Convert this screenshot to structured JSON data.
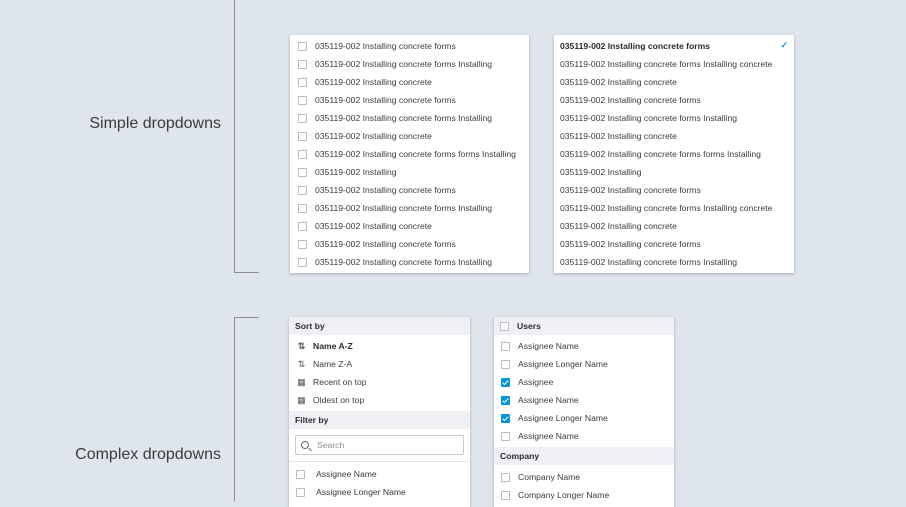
{
  "sections": {
    "simple_label": "Simple dropdowns",
    "complex_label": "Complex dropdowns"
  },
  "simple_checkbox_list": {
    "items": [
      {
        "label": "035119-002 Installing concrete forms",
        "checked": false
      },
      {
        "label": "035119-002 Installing concrete forms Installing",
        "checked": false
      },
      {
        "label": "035119-002 Installing concrete",
        "checked": false
      },
      {
        "label": "035119-002 Installing concrete forms",
        "checked": false
      },
      {
        "label": "035119-002 Installing concrete forms Installing",
        "checked": false
      },
      {
        "label": "035119-002 Installing concrete",
        "checked": false
      },
      {
        "label": "035119-002 Installing concrete forms forms Installing",
        "checked": false
      },
      {
        "label": "035119-002 Installing",
        "checked": false
      },
      {
        "label": "035119-002 Installing concrete forms",
        "checked": false
      },
      {
        "label": "035119-002 Installing concrete forms Installing",
        "checked": false
      },
      {
        "label": "035119-002 Installing concrete",
        "checked": false
      },
      {
        "label": "035119-002 Installing concrete forms",
        "checked": false
      },
      {
        "label": "035119-002 Installing concrete forms Installing",
        "checked": false
      }
    ]
  },
  "simple_select_list": {
    "items": [
      {
        "label": "035119-002 Installing concrete forms",
        "selected": true
      },
      {
        "label": "035119-002 Installing concrete forms Installing concrete",
        "selected": false
      },
      {
        "label": "035119-002 Installing concrete",
        "selected": false
      },
      {
        "label": "035119-002 Installing concrete forms",
        "selected": false
      },
      {
        "label": "035119-002 Installing concrete forms Installing",
        "selected": false
      },
      {
        "label": "035119-002 Installing concrete",
        "selected": false
      },
      {
        "label": "035119-002 Installing concrete forms forms Installing",
        "selected": false
      },
      {
        "label": "035119-002 Installing",
        "selected": false
      },
      {
        "label": "035119-002 Installing concrete forms",
        "selected": false
      },
      {
        "label": "035119-002 Installing concrete forms Installing concrete",
        "selected": false
      },
      {
        "label": "035119-002 Installing concrete",
        "selected": false
      },
      {
        "label": "035119-002 Installing concrete forms",
        "selected": false
      },
      {
        "label": "035119-002 Installing concrete forms Installing",
        "selected": false
      }
    ]
  },
  "sort_filter_panel": {
    "sort_header": "Sort by",
    "sort_options": [
      {
        "label": "Name A-Z",
        "icon": "sort-ascending-icon",
        "active": true
      },
      {
        "label": "Name Z-A",
        "icon": "sort-descending-icon",
        "active": false
      },
      {
        "label": "Recent on top",
        "icon": "calendar-recent-icon",
        "active": false
      },
      {
        "label": "Oldest on top",
        "icon": "calendar-oldest-icon",
        "active": false
      }
    ],
    "filter_header": "Filter by",
    "search_placeholder": "Search",
    "filter_items": [
      {
        "label": "Assignee Name",
        "checked": false
      },
      {
        "label": "Assignee Longer Name",
        "checked": false
      }
    ]
  },
  "grouped_panel": {
    "users_header": "Users",
    "users": [
      {
        "label": "Assignee Name",
        "checked": false
      },
      {
        "label": "Assignee Longer Name",
        "checked": false
      },
      {
        "label": "Assignee",
        "checked": true
      },
      {
        "label": "Assignee Name",
        "checked": true
      },
      {
        "label": "Assignee Longer Name",
        "checked": true
      },
      {
        "label": "Assignee Name",
        "checked": false
      }
    ],
    "company_header": "Company",
    "companies": [
      {
        "label": "Company Name",
        "checked": false
      },
      {
        "label": "Company Longer Name",
        "checked": false
      }
    ]
  },
  "colors": {
    "background": "#dfe5ec",
    "accent": "#0696d7",
    "group_header_bg": "#eef0f3"
  }
}
